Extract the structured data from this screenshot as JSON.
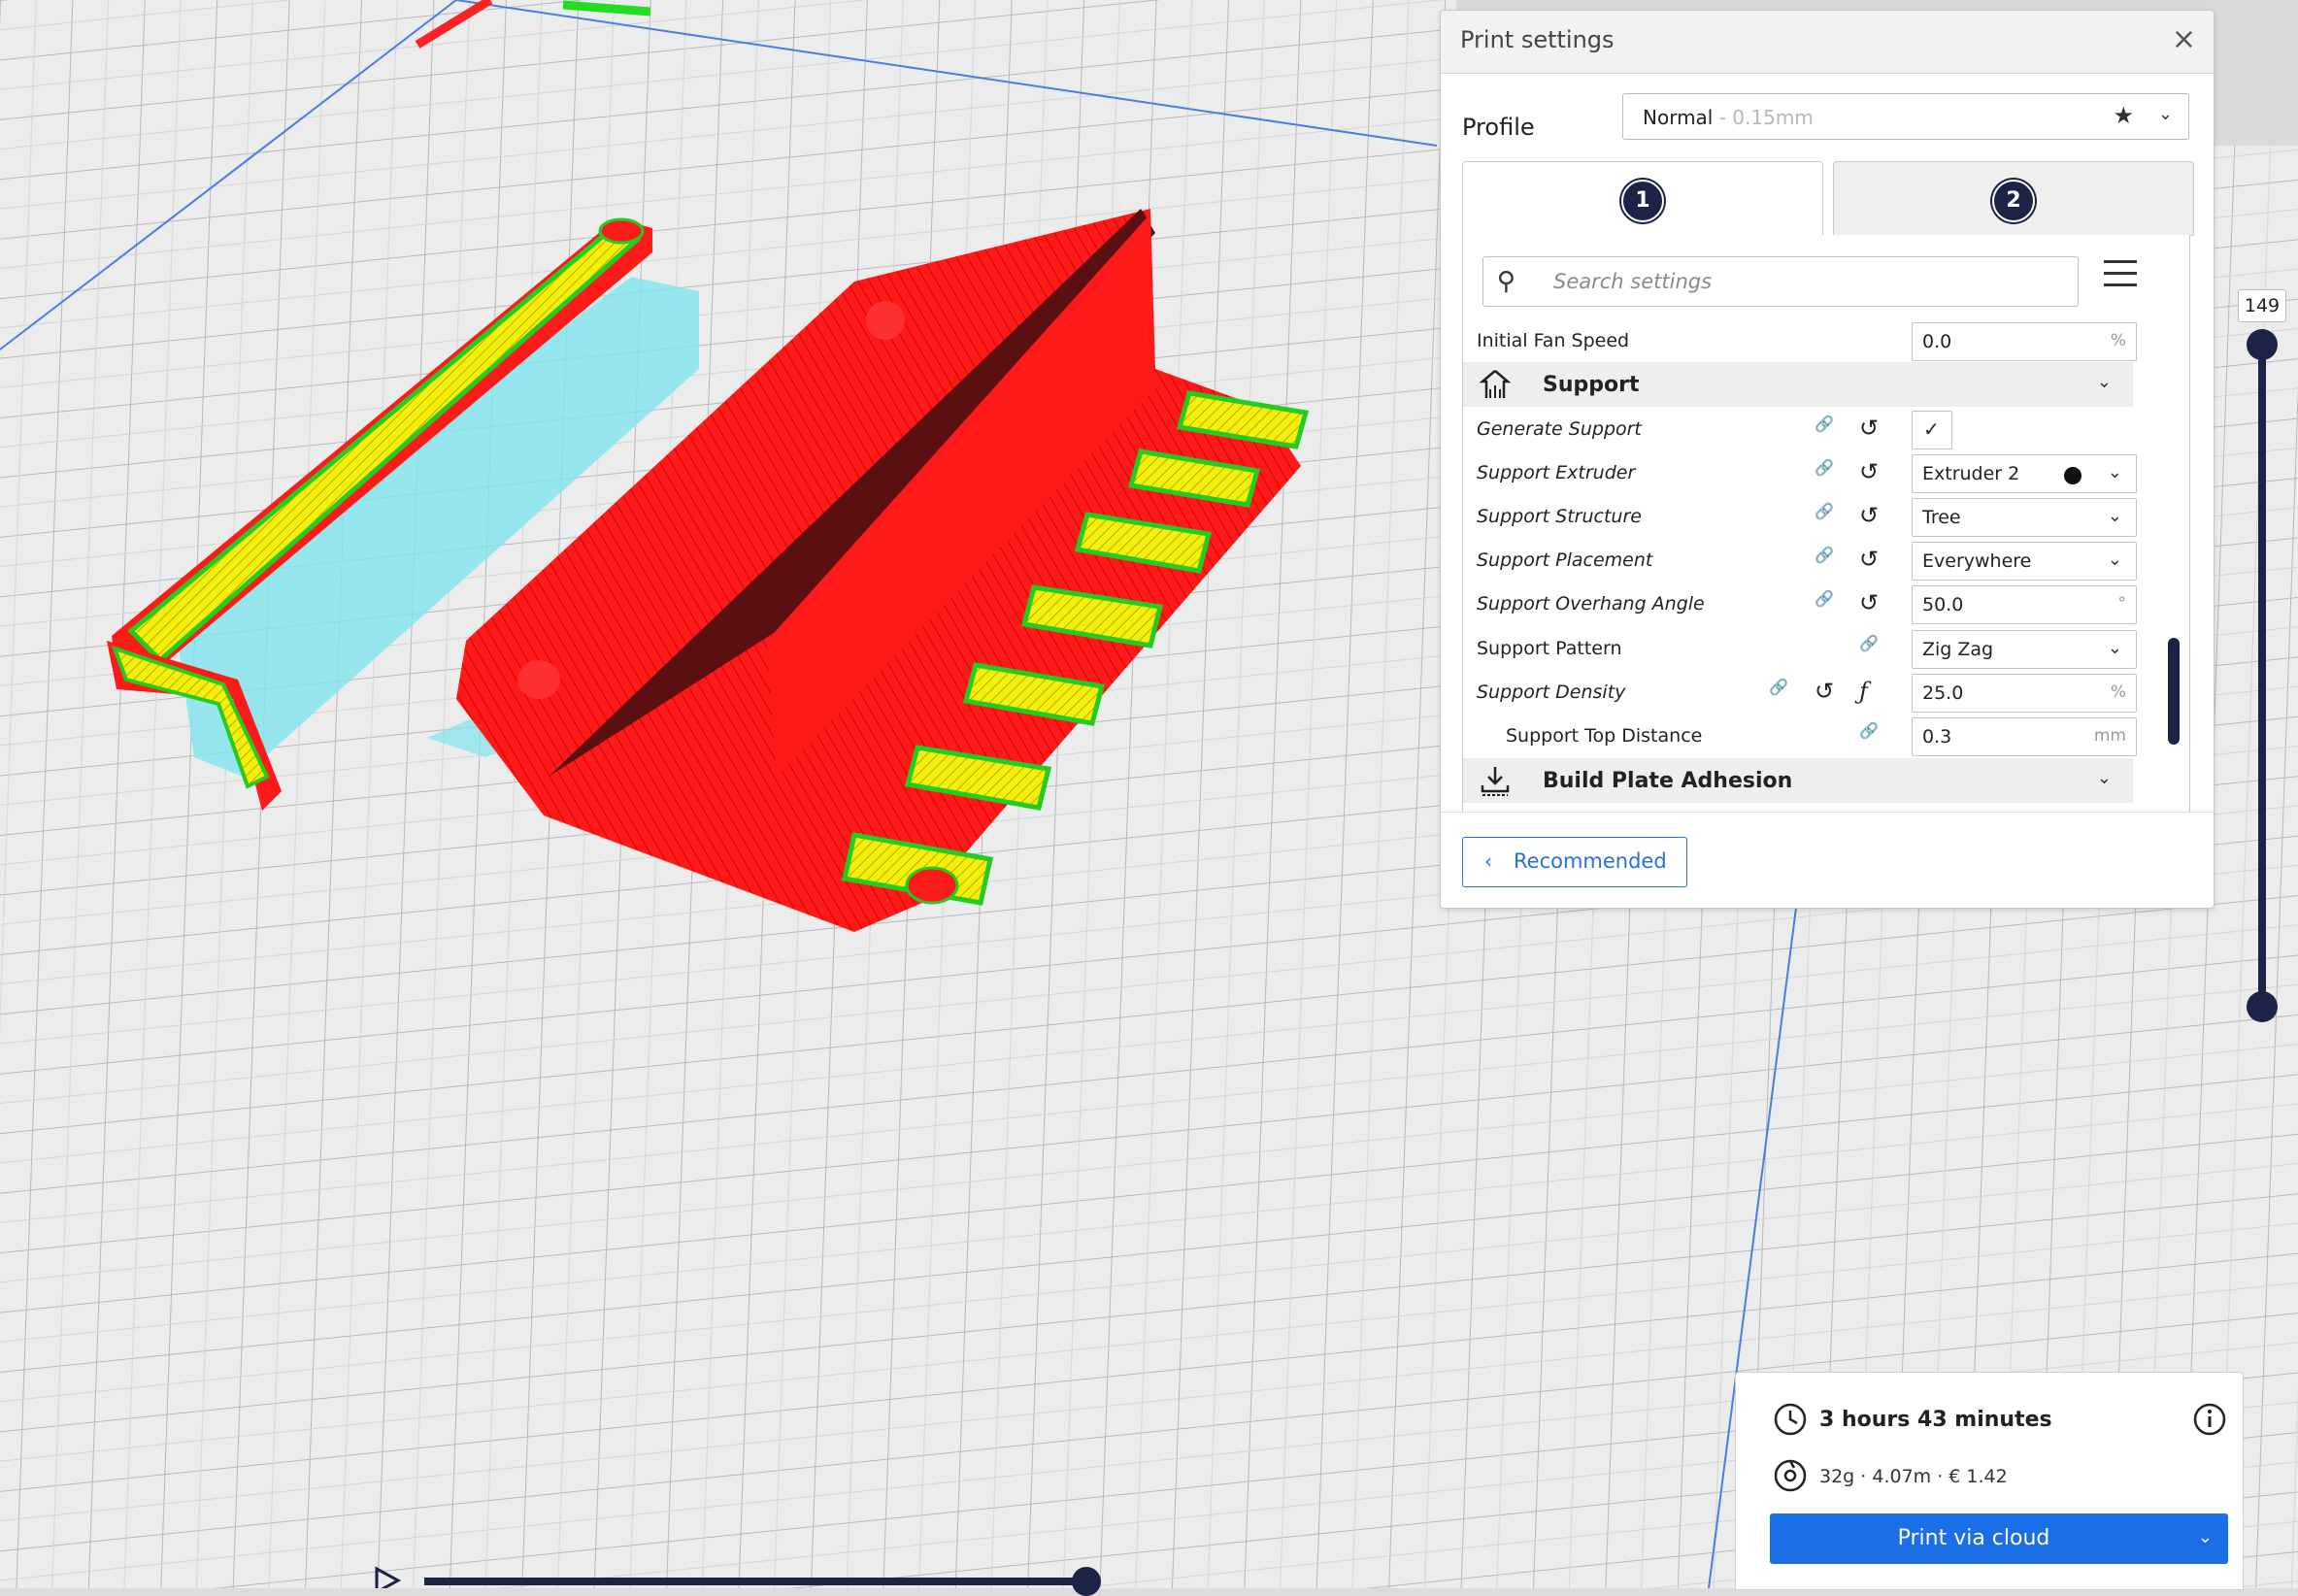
{
  "panel": {
    "title": "Print settings",
    "close_glyph": "×",
    "profile_label": "Profile",
    "profile_name": "Normal",
    "profile_sub": " - 0.15mm",
    "tabs": [
      "1",
      "2"
    ],
    "search_placeholder": "Search settings",
    "settings": [
      {
        "label": "Initial Fan Speed",
        "value": "0.0",
        "unit": "%"
      },
      {
        "category": "Support"
      },
      {
        "label": "Generate Support",
        "checked": true
      },
      {
        "label": "Support Extruder",
        "value": "Extruder 2"
      },
      {
        "label": "Support Structure",
        "value": "Tree"
      },
      {
        "label": "Support Placement",
        "value": "Everywhere"
      },
      {
        "label": "Support Overhang Angle",
        "value": "50.0",
        "unit": "°"
      },
      {
        "label": "Support Pattern",
        "value": "Zig Zag"
      },
      {
        "label": "Support Density",
        "value": "25.0",
        "unit": "%"
      },
      {
        "label": "Support Top Distance",
        "value": "0.3",
        "unit": "mm"
      },
      {
        "category": "Build Plate Adhesion"
      }
    ],
    "recommended_label": "Recommended"
  },
  "layer_slider": {
    "value": "149"
  },
  "summary": {
    "time": "3 hours 43 minutes",
    "cost": "32g · 4.07m · € 1.42",
    "print_button": "Print via cloud"
  },
  "colors": {
    "accent": "#1a6ee6",
    "dark_navy": "#1c2347",
    "model_red": "#ff1a1a",
    "infill_yellow": "#f5f00a",
    "wall_green": "#22cc22",
    "support_cyan": "#7fe6ee",
    "build_plate": "#e8e8e8"
  }
}
